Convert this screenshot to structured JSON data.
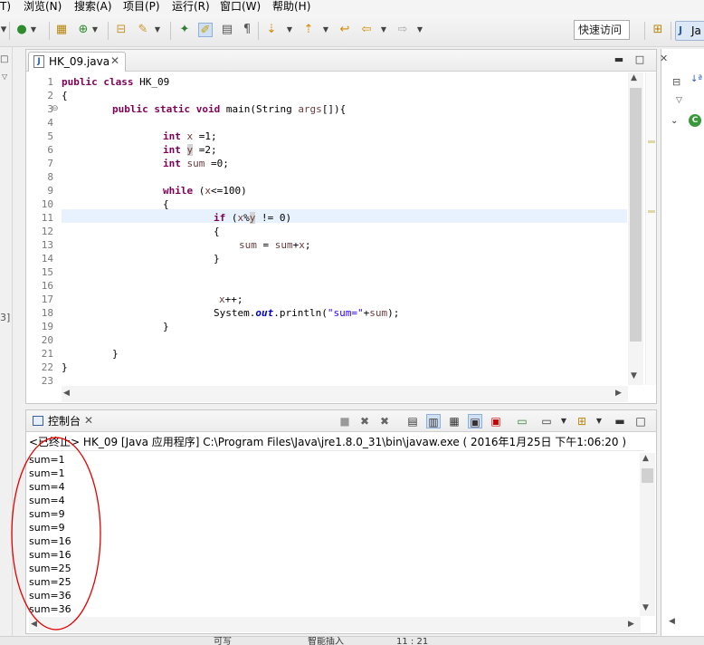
{
  "menu": [
    "T)",
    "浏览(N)",
    "搜索(A)",
    "项目(P)",
    "运行(R)",
    "窗口(W)",
    "帮助(H)"
  ],
  "toolbar": {
    "quick_access": "快速访问"
  },
  "perspective": {
    "label": "Ja"
  },
  "editor": {
    "tab_title": "HK_09.java",
    "line_numbers": [
      "1",
      "2",
      "3",
      "4",
      "5",
      "6",
      "7",
      "8",
      "9",
      "10",
      "11",
      "12",
      "13",
      "14",
      "15",
      "16",
      "17",
      "18",
      "19",
      "20",
      "21",
      "22",
      "23"
    ],
    "code": {
      "l1_kw": "public class",
      "l1_rest": " HK_09",
      "l2": "{",
      "l3_kw": "public static void",
      "l3_main": " main(String ",
      "l3_args": "args",
      "l3_end": "[]){",
      "l5_kw": "int",
      "l5_var": " x",
      "l5_end": " =1;",
      "l6_kw": "int",
      "l6_var": "y",
      "l6_end": " =2;",
      "l7_kw": "int",
      "l7_var": " sum",
      "l7_end": " =0;",
      "l9_kw": "while",
      "l9_a": " (",
      "l9_var": "x",
      "l9_end": "<=100)",
      "l10": "{",
      "l11_kw": "if",
      "l11_a": " (",
      "l11_x": "x",
      "l11_pct": "%",
      "l11_y": "y",
      "l11_end": " != 0)",
      "l12": "{",
      "l13_sum": "sum",
      "l13_eq": " = ",
      "l13_sum2": "sum",
      "l13_plus": "+",
      "l13_x": "x",
      "l13_end": ";",
      "l14": "}",
      "l17_x": "x",
      "l17_end": "++;",
      "l18_sys": "System.",
      "l18_out": "out",
      "l18_print": ".println(",
      "l18_str": "\"sum=\"",
      "l18_plus": "+",
      "l18_sum": "sum",
      "l18_end": ");",
      "l19": "}",
      "l21": "}",
      "l22": "}"
    }
  },
  "console": {
    "tab_title": "控制台",
    "header": "<已终止> HK_09 [Java 应用程序] C:\\Program Files\\Java\\jre1.8.0_31\\bin\\javaw.exe ( 2016年1月25日 下午1:06:20 )",
    "output": [
      "sum=1",
      "sum=1",
      "sum=4",
      "sum=4",
      "sum=9",
      "sum=9",
      "sum=16",
      "sum=16",
      "sum=25",
      "sum=25",
      "sum=36",
      "sum=36"
    ]
  },
  "status": {
    "writable": "可写",
    "insert": "智能插入",
    "position": "11 : 21"
  },
  "left_strip": {
    "marker": "3]"
  },
  "colors": {
    "keyword": "#7f0055",
    "string": "#2a00ff",
    "field": "#0000c0",
    "highlight": "#e8f2fe",
    "annotation": "#e60000"
  }
}
